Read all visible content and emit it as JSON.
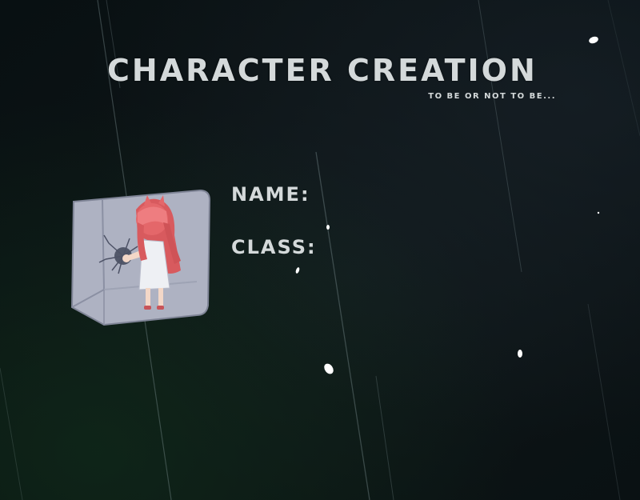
{
  "screen": {
    "title": "Character Creation",
    "subtitle": "To be or not to be..."
  },
  "form": {
    "name_label": "Name:",
    "name_value": "",
    "class_label": "Class:",
    "class_value": ""
  },
  "portrait": {
    "icon": "character-portrait-red-haired-girl-cracked-wall"
  },
  "colors": {
    "background": "#0b1114",
    "text": "#d4d9da",
    "portrait_wall": "#a9adbd",
    "hair": "#e06a6c"
  }
}
